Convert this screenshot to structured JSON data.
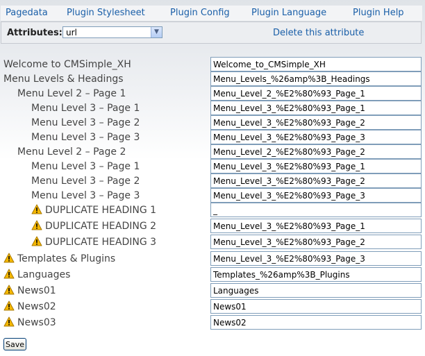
{
  "menu": {
    "items": [
      "Pagedata",
      "Plugin Stylesheet",
      "Plugin Config",
      "Plugin Language",
      "Plugin Help"
    ]
  },
  "attributes": {
    "label": "Attributes:",
    "selected": "url",
    "delete_label": "Delete this attribute"
  },
  "rows": [
    {
      "label": "Welcome to CMSimple_XH",
      "value": "Welcome_to_CMSimple_XH",
      "warn": false
    },
    {
      "label": "Menu Levels & Headings",
      "value": "Menu_Levels_%26amp%3B_Headings",
      "warn": false
    },
    {
      "label": "Menu Level 2 – Page 1",
      "value": "Menu_Level_2_%E2%80%93_Page_1",
      "warn": false
    },
    {
      "label": "Menu Level 3 – Page 1",
      "value": "Menu_Level_3_%E2%80%93_Page_1",
      "warn": false
    },
    {
      "label": "Menu Level 3 – Page 2",
      "value": "Menu_Level_3_%E2%80%93_Page_2",
      "warn": false
    },
    {
      "label": "Menu Level 3 – Page 3",
      "value": "Menu_Level_3_%E2%80%93_Page_3",
      "warn": false
    },
    {
      "label": "Menu Level 2 – Page 2",
      "value": "Menu_Level_2_%E2%80%93_Page_2",
      "warn": false
    },
    {
      "label": "Menu Level 3 – Page 1",
      "value": "Menu_Level_3_%E2%80%93_Page_1",
      "warn": false
    },
    {
      "label": "Menu Level 3 – Page 2",
      "value": "Menu_Level_3_%E2%80%93_Page_2",
      "warn": false
    },
    {
      "label": "Menu Level 3 – Page 3",
      "value": "Menu_Level_3_%E2%80%93_Page_3",
      "warn": false
    },
    {
      "label": "DUPLICATE HEADING 1",
      "value": "_",
      "warn": true
    },
    {
      "label": "DUPLICATE HEADING 2",
      "value": "Menu_Level_3_%E2%80%93_Page_1",
      "warn": true
    },
    {
      "label": "DUPLICATE HEADING 3",
      "value": "Menu_Level_3_%E2%80%93_Page_2",
      "warn": true
    },
    {
      "label": "Templates & Plugins",
      "value": "Menu_Level_3_%E2%80%93_Page_3",
      "warn": true
    },
    {
      "label": "Languages",
      "value": "Templates_%26amp%3B_Plugins",
      "warn": true
    },
    {
      "label": "News01",
      "value": "Languages",
      "warn": true
    },
    {
      "label": "News02",
      "value": "News01",
      "warn": true
    },
    {
      "label": "News03",
      "value": "News02",
      "warn": true
    }
  ],
  "save_label": "Save",
  "colors": {
    "link": "#1a5fa8",
    "warning": "#f5b800"
  },
  "icons": {
    "warning": "warning-icon",
    "dropdown": "chevron-down-icon"
  }
}
